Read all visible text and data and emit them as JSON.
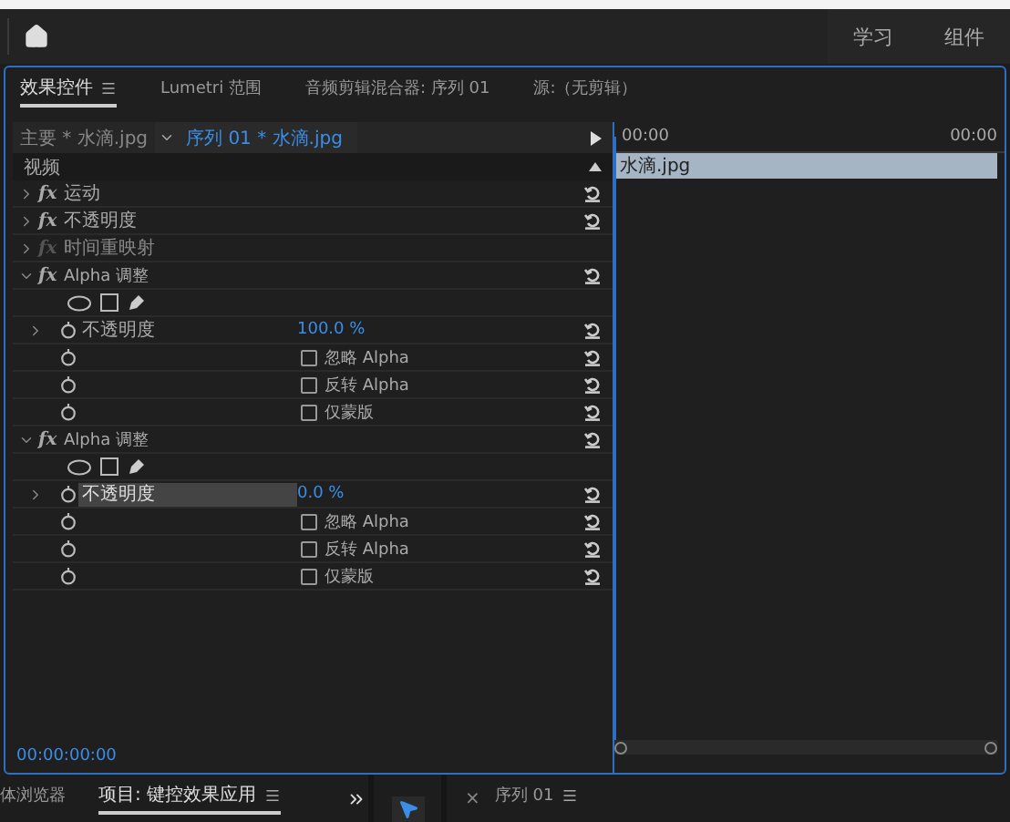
{
  "header": {
    "items": [
      {
        "label": "学习",
        "selected": false
      },
      {
        "label": "组件",
        "selected": false
      }
    ]
  },
  "panel_tabs": [
    {
      "label": "效果控件",
      "selected": true,
      "menu": true
    },
    {
      "label": "Lumetri 范围",
      "selected": false,
      "menu": false
    },
    {
      "label": "音频剪辑混合器: 序列 01",
      "selected": false,
      "menu": false
    },
    {
      "label": "源:（无剪辑）",
      "selected": false,
      "menu": false
    }
  ],
  "source": {
    "master": "主要 * 水滴.jpg",
    "sequence": "序列 01 * 水滴.jpg"
  },
  "section": "视频",
  "rows": [
    {
      "kind": "effect",
      "label": "运动",
      "fx": "fx",
      "expanded": false,
      "disabled": false,
      "reset": true
    },
    {
      "kind": "effect",
      "label": "不透明度",
      "fx": "fx",
      "expanded": false,
      "disabled": false,
      "reset": true
    },
    {
      "kind": "effect",
      "label": "时间重映射",
      "fx": "fx",
      "expanded": false,
      "disabled": true,
      "reset": false
    },
    {
      "kind": "effect",
      "label": "Alpha 调整",
      "fx": "fx",
      "expanded": true,
      "disabled": false,
      "reset": true
    },
    {
      "kind": "masks"
    },
    {
      "kind": "param",
      "label": "不透明度",
      "value": "100.0 %",
      "highlighted": false
    },
    {
      "kind": "checkbox",
      "label": "忽略 Alpha",
      "checked": false
    },
    {
      "kind": "checkbox",
      "label": "反转 Alpha",
      "checked": false
    },
    {
      "kind": "checkbox",
      "label": "仅蒙版",
      "checked": false
    },
    {
      "kind": "effect",
      "label": "Alpha 调整",
      "fx": "fx",
      "expanded": true,
      "disabled": false,
      "reset": true
    },
    {
      "kind": "masks"
    },
    {
      "kind": "param",
      "label": "不透明度",
      "value": "0.0 %",
      "highlighted": true
    },
    {
      "kind": "checkbox",
      "label": "忽略 Alpha",
      "checked": false
    },
    {
      "kind": "checkbox",
      "label": "反转 Alpha",
      "checked": false
    },
    {
      "kind": "checkbox",
      "label": "仅蒙版",
      "checked": false
    }
  ],
  "timeline": {
    "start": "00:00",
    "end": "00:00",
    "clip": "水滴.jpg"
  },
  "timecode": "00:00:00:00",
  "bottom_tabs": [
    {
      "label": "体浏览器",
      "selected": false,
      "menu": false
    },
    {
      "label": "项目: 键控效果应用",
      "selected": true,
      "menu": true
    }
  ],
  "sequence_tab": {
    "close": "×",
    "label": "序列 01"
  }
}
